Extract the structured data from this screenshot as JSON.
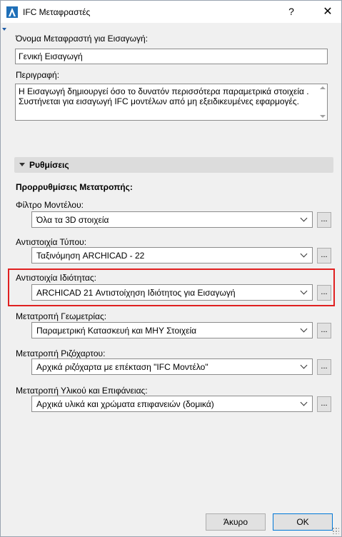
{
  "window": {
    "title": "IFC Μεταφραστές",
    "help_label": "?",
    "close_label": "✕",
    "app_icon": "archicad-logo-icon"
  },
  "fields": {
    "translator_name_label": "Όνομα Μεταφραστή για Εισαγωγή:",
    "translator_name_value": "Γενική Εισαγωγή",
    "description_label": "Περιγραφή:",
    "description_line1": "Η Εισαγωγή δημιουργεί όσο το δυνατόν περισσότερα παραμετρικά στοιχεία .",
    "description_line2": "Συστήνεται για εισαγωγή IFC μοντέλων από μη εξειδικευμένες εφαρμογές."
  },
  "settings": {
    "section_title": "Ρυθμίσεις",
    "presets_title": "Προρρυθμίσεις Μετατροπής:",
    "rows": [
      {
        "label": "Φίλτρο Μοντέλου:",
        "value": "Όλα τα 3D στοιχεία",
        "more": "..."
      },
      {
        "label": "Αντιστοιχία Τύπου:",
        "value": "Ταξινόμηση ARCHICAD - 22",
        "more": "..."
      },
      {
        "label": "Αντιστοιχία Ιδιότητας:",
        "value": "ARCHICAD 21 Αντιστοίχηση Ιδιότητος για Εισαγωγή",
        "more": "..."
      },
      {
        "label": "Μετατροπή Γεωμετρίας:",
        "value": "Παραμετρική Κατασκευή και ΜΗΥ Στοιχεία",
        "more": "..."
      },
      {
        "label": "Μετατροπή Ριζόχαρτου:",
        "value": "Αρχικά ριζόχαρτα με επέκταση \"IFC Μοντέλο\"",
        "more": "..."
      },
      {
        "label": "Μετατροπή Υλικού και Επιφάνειας:",
        "value": "Αρχικά υλικά και χρώματα επιφανειών (δομικά)",
        "more": "..."
      }
    ]
  },
  "footer": {
    "cancel_label": "Άκυρο",
    "ok_label": "OK"
  },
  "colors": {
    "highlight": "#e02020",
    "ok_border": "#0078d7"
  }
}
